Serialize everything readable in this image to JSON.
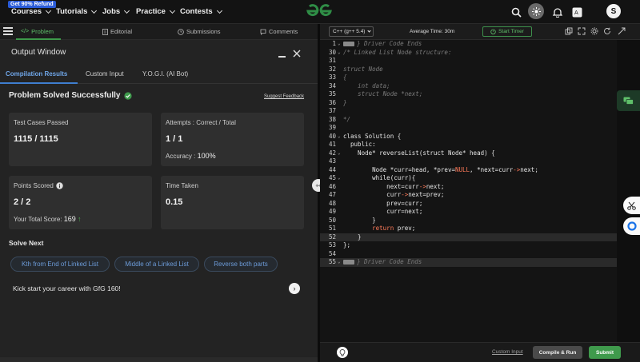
{
  "topnav": {
    "refund_badge": "Get 90% Refund",
    "items": [
      "Courses",
      "Tutorials",
      "Jobs",
      "Practice",
      "Contests"
    ],
    "avatar_letter": "S"
  },
  "left_tabs": {
    "problem": "Problem",
    "editorial": "Editorial",
    "submissions": "Submissions",
    "comments": "Comments"
  },
  "output": {
    "title": "Output Window",
    "tabs": [
      "Compilation Results",
      "Custom Input",
      "Y.O.G.I. (AI Bot)"
    ],
    "status": "Problem Solved Successfully",
    "suggest_feedback": "Suggest Feedback",
    "test_cases": {
      "label": "Test Cases Passed",
      "value": "1115 / 1115"
    },
    "attempts": {
      "label": "Attempts : Correct / Total",
      "value": "1 / 1",
      "accuracy_label": "Accuracy :",
      "accuracy_value": "100%"
    },
    "points": {
      "label": "Points Scored",
      "value": "2 / 2",
      "total_label": "Your Total Score:",
      "total_value": "169"
    },
    "time": {
      "label": "Time Taken",
      "value": "0.15"
    },
    "solve_next_title": "Solve Next",
    "solve_next": [
      "Kth from End of Linked List",
      "Middle of a Linked List",
      "Reverse both parts"
    ],
    "kickstart": "Kick start your career with GfG 160!"
  },
  "editor_bar": {
    "language": "C++ (g++ 5.4)",
    "avg_time": "Average Time: 30m",
    "start_timer": "Start Timer"
  },
  "code_lines": [
    {
      "n": "1",
      "fold": true,
      "marker": true,
      "text": "} Driver Code Ends",
      "cls": "cmt"
    },
    {
      "n": "30",
      "fold": true,
      "text": "/* Linked List Node structure:",
      "cls": "cmt"
    },
    {
      "n": "31",
      "text": "",
      "cls": "cmt"
    },
    {
      "n": "32",
      "text": "struct Node",
      "cls": "cmt"
    },
    {
      "n": "33",
      "text": "{",
      "cls": "cmt"
    },
    {
      "n": "34",
      "text": "    int data;",
      "cls": "cmt"
    },
    {
      "n": "35",
      "text": "    struct Node *next;",
      "cls": "cmt"
    },
    {
      "n": "36",
      "text": "}",
      "cls": "cmt"
    },
    {
      "n": "37",
      "text": "",
      "cls": "cmt"
    },
    {
      "n": "38",
      "text": "*/",
      "cls": "cmt"
    },
    {
      "n": "39",
      "text": "",
      "cls": "plain"
    },
    {
      "n": "40",
      "fold": true,
      "text": "class Solution {",
      "cls": "plain"
    },
    {
      "n": "41",
      "text": "  public:",
      "cls": "plain"
    },
    {
      "n": "42",
      "fold": true,
      "text": "    Node* reverseList(struct Node* head) {",
      "cls": "plain"
    },
    {
      "n": "43",
      "text": "",
      "cls": "plain"
    },
    {
      "n": "44",
      "text": "        Node *curr=head, *prev=NULL, *next=curr->next;",
      "cls": "plain"
    },
    {
      "n": "45",
      "fold": true,
      "text": "        while(curr){",
      "cls": "plain"
    },
    {
      "n": "46",
      "text": "            next=curr->next;",
      "cls": "plain"
    },
    {
      "n": "47",
      "text": "            curr->next=prev;",
      "cls": "plain"
    },
    {
      "n": "48",
      "text": "            prev=curr;",
      "cls": "plain"
    },
    {
      "n": "49",
      "text": "            curr=next;",
      "cls": "plain"
    },
    {
      "n": "50",
      "text": "        }",
      "cls": "plain"
    },
    {
      "n": "51",
      "text": "        return prev;",
      "cls": "plain"
    },
    {
      "n": "52",
      "highlight": true,
      "text": "    }",
      "cls": "plain"
    },
    {
      "n": "53",
      "text": "};",
      "cls": "plain"
    },
    {
      "n": "54",
      "text": "",
      "cls": "plain"
    },
    {
      "n": "55",
      "fold": true,
      "marker": true,
      "highlight": true,
      "text": "} Driver Code Ends",
      "cls": "cmt"
    }
  ],
  "bottom": {
    "custom_input": "Custom Input",
    "compile_run": "Compile & Run",
    "submit": "Submit"
  },
  "colors": {
    "accent_green": "#3f9a4c",
    "accent_blue": "#3f7fd0",
    "keyword": "#ff7a59"
  }
}
